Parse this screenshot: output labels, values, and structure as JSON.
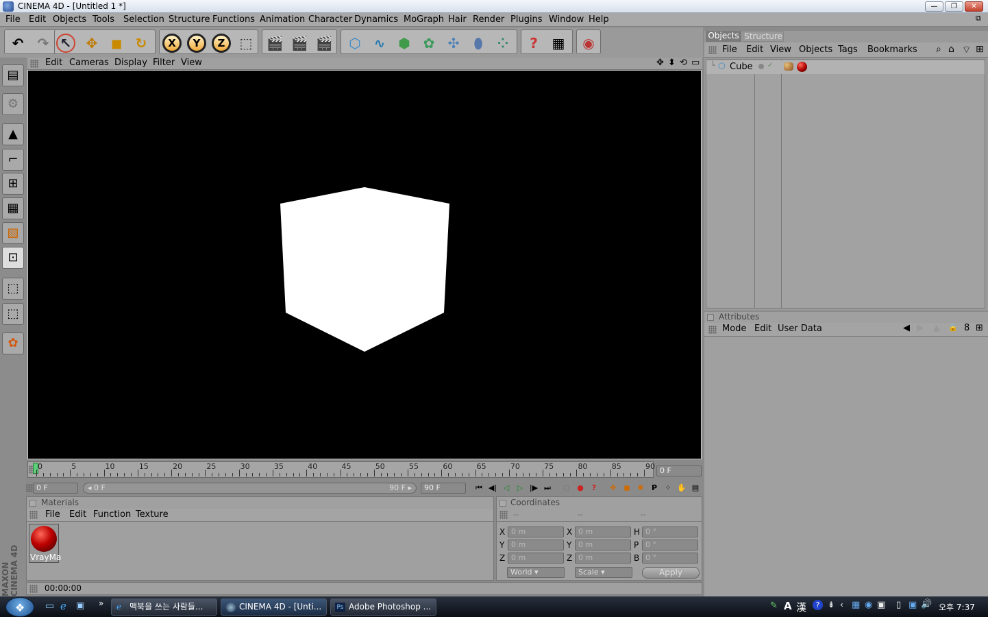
{
  "window": {
    "title": "CINEMA 4D - [Untitled 1 *]",
    "min": "—",
    "max": "❐",
    "close": "✕"
  },
  "menu": [
    "File",
    "Edit",
    "Objects",
    "Tools",
    "Selection",
    "Structure",
    "Functions",
    "Animation",
    "Character",
    "Dynamics",
    "MoGraph",
    "Hair",
    "Render",
    "Plugins",
    "Window",
    "Help"
  ],
  "toolbar": {
    "undo": "↶",
    "redo": "↷",
    "select": "↖",
    "move": "✥",
    "scale": "◼",
    "rotate": "↻",
    "x": "X",
    "y": "Y",
    "z": "Z",
    "coord": "⬚",
    "render_view": "🎬",
    "render_pv": "🎬",
    "render_settings": "🎬",
    "cube": "⬡",
    "spline": "∿",
    "nurbs": "⬢",
    "array": "✿",
    "deformer": "✣",
    "scene": "⬮",
    "particle": "⁘",
    "help": "?",
    "layout": "▦",
    "web": "◉"
  },
  "left_tools": [
    "▤",
    "⚙",
    "▲",
    "⌐",
    "⊞",
    "▦",
    "▧",
    "⊡",
    "⬚",
    "⬚",
    "✿"
  ],
  "maxon": "MAXON CINEMA 4D",
  "viewport_menu": [
    "Edit",
    "Cameras",
    "Display",
    "Filter",
    "View"
  ],
  "viewport_icons": [
    "✥",
    "⬍",
    "⟲",
    "▭"
  ],
  "timeline": {
    "ticks": [
      "0",
      "5",
      "10",
      "15",
      "20",
      "25",
      "30",
      "35",
      "40",
      "45",
      "50",
      "55",
      "60",
      "65",
      "70",
      "75",
      "80",
      "85",
      "90"
    ],
    "current_frame": "0 F",
    "start": "0 F",
    "range_start": "◂ 0 F",
    "range_end": "90 F ▸",
    "end": "90 F"
  },
  "transport": [
    "⏮",
    "◀|",
    "◁",
    "▷",
    "|▶",
    "⏭",
    "◌",
    "●",
    "?",
    "✥",
    "◼",
    "✺",
    "P",
    "⁘",
    "✋",
    "▤"
  ],
  "materials": {
    "header": "Materials",
    "menu": [
      "File",
      "Edit",
      "Function",
      "Texture"
    ],
    "items": [
      {
        "label": "VrayMa"
      }
    ]
  },
  "coordinates": {
    "header": "Coordinates",
    "cols": [
      "--",
      "--",
      "--"
    ],
    "rows": [
      {
        "a": "X",
        "av": "0 m",
        "b": "X",
        "bv": "0 m",
        "c": "H",
        "cv": "0 °"
      },
      {
        "a": "Y",
        "av": "0 m",
        "b": "Y",
        "bv": "0 m",
        "c": "P",
        "cv": "0 °"
      },
      {
        "a": "Z",
        "av": "0 m",
        "b": "Z",
        "bv": "0 m",
        "c": "B",
        "cv": "0 °"
      }
    ],
    "space": "World",
    "mode": "Scale",
    "apply": "Apply"
  },
  "status": {
    "time": "00:00:00"
  },
  "objects_panel": {
    "tabs": [
      "Objects",
      "Structure"
    ],
    "menu": [
      "File",
      "Edit",
      "View",
      "Objects",
      "Tags",
      "Bookmarks"
    ],
    "tools": [
      "⌕",
      "⌂",
      "⌔",
      "⊞"
    ],
    "items": [
      {
        "name": "Cube"
      }
    ]
  },
  "attributes": {
    "header": "Attributes",
    "menu": [
      "Mode",
      "Edit",
      "User Data"
    ],
    "tools": [
      "◀",
      "▶",
      "▲",
      "🔒",
      "8",
      "⊞"
    ]
  },
  "taskbar": {
    "tasks": [
      "맥북을 쓰는 사람들...",
      "CINEMA 4D - [Unti...",
      "Adobe Photoshop ..."
    ],
    "tray": [
      "A",
      "漢",
      "?"
    ],
    "clock": "오후 7:37"
  }
}
